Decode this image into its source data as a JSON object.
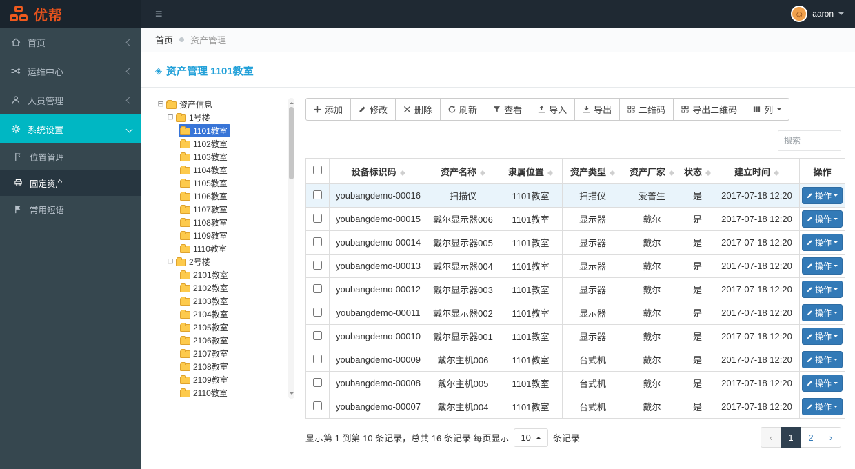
{
  "header": {
    "logo_text": "优帮",
    "user_name": "aaron"
  },
  "breadcrumb": {
    "home": "首页",
    "current": "资产管理"
  },
  "sidebar": {
    "items": [
      {
        "label": "首页"
      },
      {
        "label": "运维中心"
      },
      {
        "label": "人员管理"
      },
      {
        "label": "系统设置"
      }
    ],
    "subitems": [
      {
        "label": "位置管理"
      },
      {
        "label": "固定资产"
      },
      {
        "label": "常用短语"
      }
    ]
  },
  "page": {
    "title": "资产管理 1101教室"
  },
  "tree": {
    "root": "资产信息",
    "buildings": [
      {
        "label": "1号楼",
        "selected": "1101教室",
        "rooms": [
          "1101教室",
          "1102教室",
          "1103教室",
          "1104教室",
          "1105教室",
          "1106教室",
          "1107教室",
          "1108教室",
          "1109教室",
          "1110教室"
        ]
      },
      {
        "label": "2号楼",
        "rooms": [
          "2101教室",
          "2102教室",
          "2103教室",
          "2104教室",
          "2105教室",
          "2106教室",
          "2107教室",
          "2108教室",
          "2109教室",
          "2110教室"
        ]
      }
    ]
  },
  "toolbar": {
    "buttons": [
      {
        "label": "添加"
      },
      {
        "label": "修改"
      },
      {
        "label": "删除"
      },
      {
        "label": "刷新"
      },
      {
        "label": "查看"
      },
      {
        "label": "导入"
      },
      {
        "label": "导出"
      },
      {
        "label": "二维码"
      },
      {
        "label": "导出二维码"
      },
      {
        "label": "列"
      }
    ]
  },
  "search": {
    "placeholder": "搜索"
  },
  "table": {
    "columns": [
      "设备标识码",
      "资产名称",
      "隶属位置",
      "资产类型",
      "资产厂家",
      "状态",
      "建立时间",
      "操作"
    ],
    "action_label": "操作",
    "rows": [
      {
        "id": "youbangdemo-00016",
        "name": "扫描仪",
        "location": "1101教室",
        "type": "扫描仪",
        "vendor": "爱普生",
        "status": "是",
        "created": "2017-07-18 12:20"
      },
      {
        "id": "youbangdemo-00015",
        "name": "戴尔显示器006",
        "location": "1101教室",
        "type": "显示器",
        "vendor": "戴尔",
        "status": "是",
        "created": "2017-07-18 12:20"
      },
      {
        "id": "youbangdemo-00014",
        "name": "戴尔显示器005",
        "location": "1101教室",
        "type": "显示器",
        "vendor": "戴尔",
        "status": "是",
        "created": "2017-07-18 12:20"
      },
      {
        "id": "youbangdemo-00013",
        "name": "戴尔显示器004",
        "location": "1101教室",
        "type": "显示器",
        "vendor": "戴尔",
        "status": "是",
        "created": "2017-07-18 12:20"
      },
      {
        "id": "youbangdemo-00012",
        "name": "戴尔显示器003",
        "location": "1101教室",
        "type": "显示器",
        "vendor": "戴尔",
        "status": "是",
        "created": "2017-07-18 12:20"
      },
      {
        "id": "youbangdemo-00011",
        "name": "戴尔显示器002",
        "location": "1101教室",
        "type": "显示器",
        "vendor": "戴尔",
        "status": "是",
        "created": "2017-07-18 12:20"
      },
      {
        "id": "youbangdemo-00010",
        "name": "戴尔显示器001",
        "location": "1101教室",
        "type": "显示器",
        "vendor": "戴尔",
        "status": "是",
        "created": "2017-07-18 12:20"
      },
      {
        "id": "youbangdemo-00009",
        "name": "戴尔主机006",
        "location": "1101教室",
        "type": "台式机",
        "vendor": "戴尔",
        "status": "是",
        "created": "2017-07-18 12:20"
      },
      {
        "id": "youbangdemo-00008",
        "name": "戴尔主机005",
        "location": "1101教室",
        "type": "台式机",
        "vendor": "戴尔",
        "status": "是",
        "created": "2017-07-18 12:20"
      },
      {
        "id": "youbangdemo-00007",
        "name": "戴尔主机004",
        "location": "1101教室",
        "type": "台式机",
        "vendor": "戴尔",
        "status": "是",
        "created": "2017-07-18 12:20"
      }
    ]
  },
  "pagination": {
    "summary_before": "显示第 1 到第 10 条记录，总共 16 条记录 每页显示",
    "page_size": "10",
    "summary_after": "条记录",
    "prev_label": "‹",
    "next_label": "›",
    "pages": [
      "1",
      "2"
    ]
  }
}
